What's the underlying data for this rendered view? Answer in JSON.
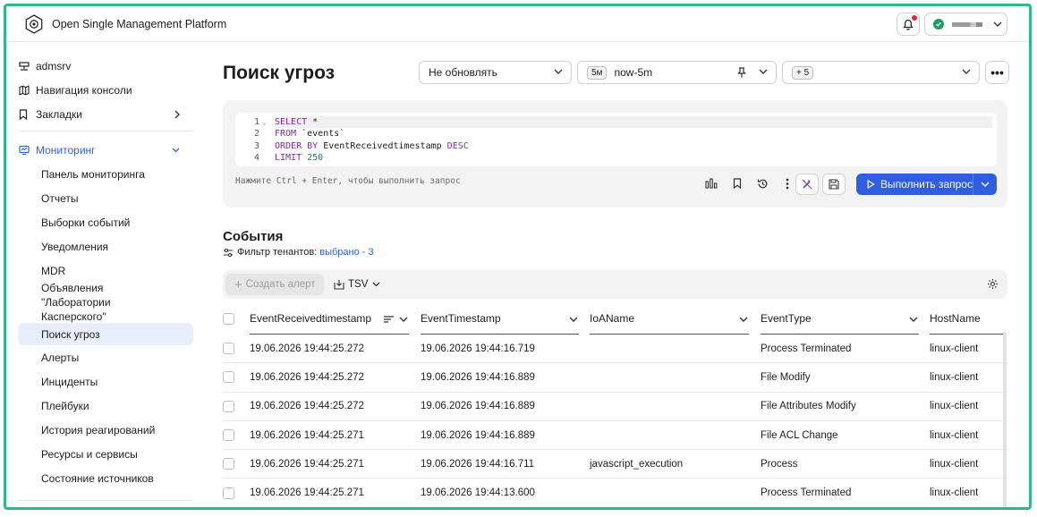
{
  "app": {
    "title": "Open Single Management Platform"
  },
  "sidebar": {
    "top": [
      {
        "label": "admsrv",
        "icon": "server-icon"
      },
      {
        "label": "Навигация консоли",
        "icon": "map-icon"
      },
      {
        "label": "Закладки",
        "icon": "bookmark-icon"
      }
    ],
    "section": {
      "label": "Мониторинг",
      "icon": "monitor-icon"
    },
    "items": [
      {
        "label": "Панель мониторинга"
      },
      {
        "label": "Отчеты"
      },
      {
        "label": "Выборки событий"
      },
      {
        "label": "Уведомления"
      },
      {
        "label": "MDR"
      },
      {
        "label": "Объявления \"Лаборатории Касперского\""
      },
      {
        "label": "Поиск угроз",
        "active": true
      },
      {
        "label": "Алерты"
      },
      {
        "label": "Инциденты"
      },
      {
        "label": "Плейбуки"
      },
      {
        "label": "История реагирований"
      },
      {
        "label": "Ресурсы и сервисы"
      },
      {
        "label": "Состояние источников"
      }
    ]
  },
  "page": {
    "title": "Поиск угроз",
    "refresh_select": "Не обновлять",
    "time_badge": "5м",
    "time_range": "now-5m",
    "tenants_badge": "+ 5"
  },
  "query": {
    "lines": [
      {
        "n": "1",
        "kw1": "SELECT",
        "rest": " *",
        "kw2": "",
        "num": ""
      },
      {
        "n": "2",
        "kw1": "FROM",
        "rest": " `events`",
        "kw2": "",
        "num": ""
      },
      {
        "n": "3",
        "kw1": "ORDER BY",
        "rest": " EventReceivedtimestamp ",
        "kw2": "DESC",
        "num": ""
      },
      {
        "n": "4",
        "kw1": "LIMIT",
        "rest": " ",
        "kw2": "",
        "num": "250"
      }
    ],
    "hint": "Нажмите Ctrl + Enter, чтобы выполнить запрос",
    "run_label": "Выполнить запрос"
  },
  "events": {
    "title": "События",
    "tenant_filter_label": "Фильтр тенантов:",
    "tenant_filter_value": "выбрано - 3",
    "create_alert_label": "Создать алерт",
    "export_label": "TSV",
    "columns": [
      "EventReceivedtimestamp",
      "EventTimestamp",
      "IoAName",
      "EventType",
      "HostName"
    ],
    "rows": [
      [
        "19.06.2026 19:44:25.272",
        "19.06.2026 19:44:16.719",
        "",
        "Process Terminated",
        "linux-client"
      ],
      [
        "19.06.2026 19:44:25.272",
        "19.06.2026 19:44:16.889",
        "",
        "File Modify",
        "linux-client"
      ],
      [
        "19.06.2026 19:44:25.272",
        "19.06.2026 19:44:16.889",
        "",
        "File Attributes Modify",
        "linux-client"
      ],
      [
        "19.06.2026 19:44:25.271",
        "19.06.2026 19:44:16.889",
        "",
        "File ACL Change",
        "linux-client"
      ],
      [
        "19.06.2026 19:44:25.271",
        "19.06.2026 19:44:16.711",
        "javascript_execution",
        "Process",
        "linux-client"
      ],
      [
        "19.06.2026 19:44:25.271",
        "19.06.2026 19:44:13.600",
        "",
        "Process Terminated",
        "linux-client"
      ]
    ]
  },
  "colors": {
    "accent": "#2f5fe0",
    "frame": "#2db98a",
    "active_bg": "#e8eefb",
    "notify": "#e3223f",
    "ok": "#1aa060"
  }
}
